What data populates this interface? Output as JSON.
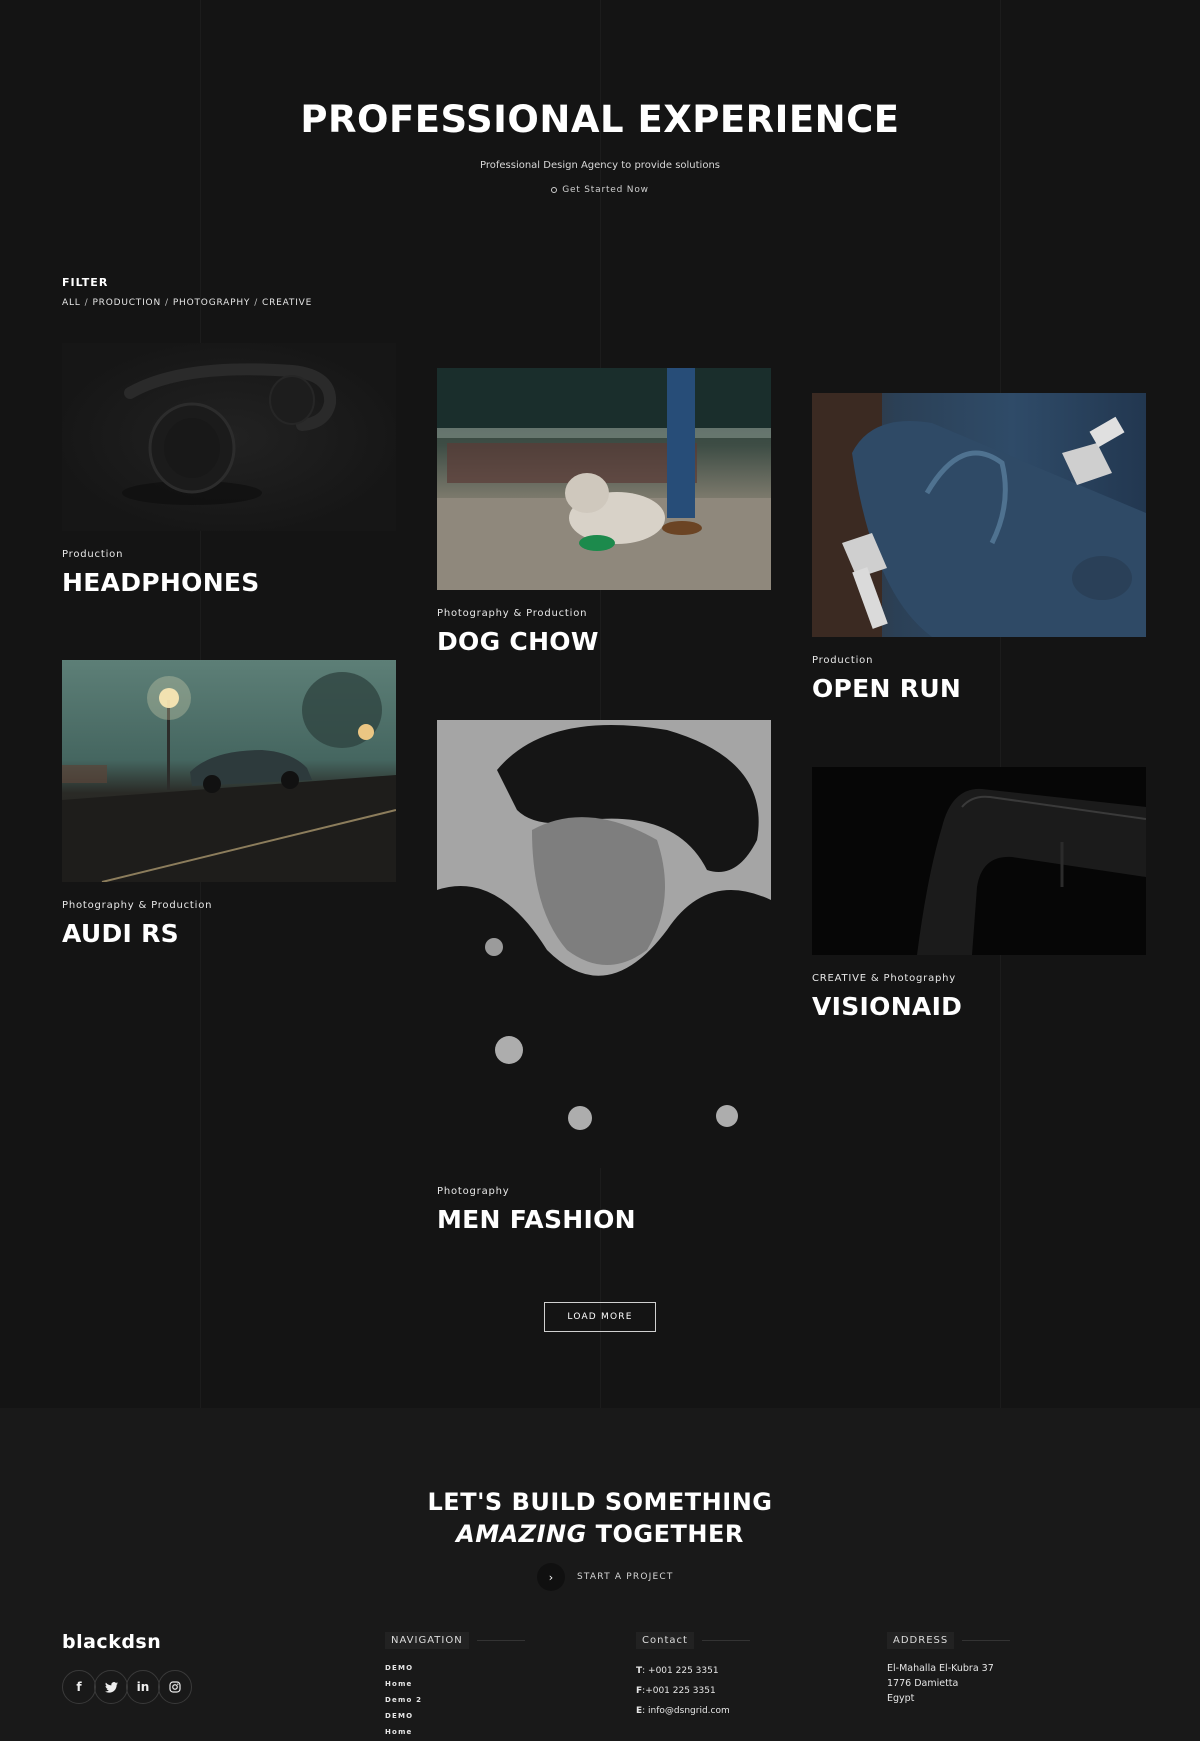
{
  "hero": {
    "title": "PROFESSIONAL EXPERIENCE",
    "subtitle": "Professional Design Agency to provide solutions",
    "cta": "Get Started Now"
  },
  "filter": {
    "title": "FILTER",
    "items": [
      "ALL",
      "PRODUCTION",
      "PHOTOGRAPHY",
      "CREATIVE"
    ],
    "separator": "/"
  },
  "projects": [
    {
      "category": "Production",
      "name": "HEADPHONES"
    },
    {
      "category": "Photography & Production",
      "name": "DOG CHOW"
    },
    {
      "category": "Production",
      "name": "OPEN RUN"
    },
    {
      "category": "Photography & Production",
      "name": "AUDI RS"
    },
    {
      "category": "Photography",
      "name": "MEN FASHION"
    },
    {
      "category": "CREATIVE & Photography",
      "name": "VISIONAID"
    }
  ],
  "load_more": "LOAD MORE",
  "footer": {
    "cta_line1": "LET'S BUILD SOMETHING",
    "cta_emph": "AMAZING",
    "cta_line2_rest": "TOGETHER",
    "start_project": "START A PROJECT",
    "brand": "blackdsn",
    "socials": [
      "facebook-icon",
      "twitter-icon",
      "linkedin-icon",
      "instagram-icon"
    ],
    "navigation": {
      "title": "NAVIGATION",
      "links": [
        "DEMO",
        "Home",
        "Demo 2",
        "DEMO",
        "Home"
      ]
    },
    "contact": {
      "title": "Contact",
      "phone_label": "T",
      "phone": ": +001 225 3351",
      "fax_label": "F",
      "fax": ":+001 225 3351",
      "email_label": "E",
      "email": ": info@dsngrid.com"
    },
    "address": {
      "title": "ADDRESS",
      "lines": [
        "El-Mahalla El-Kubra 37",
        "1776 Damietta",
        "Egypt"
      ]
    }
  }
}
